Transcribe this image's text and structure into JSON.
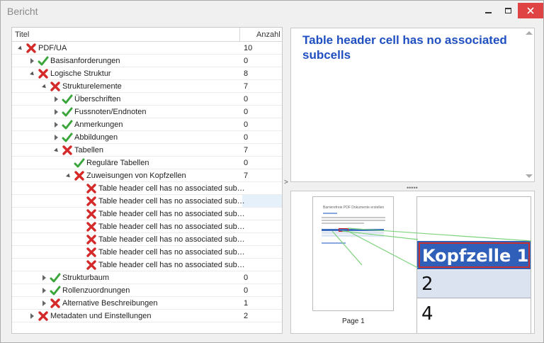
{
  "window": {
    "title": "Bericht"
  },
  "tree": {
    "col_title": "Titel",
    "col_count": "Anzahl",
    "rows": [
      {
        "label": "PDF/UA",
        "count": "10",
        "status": "fail",
        "expander": "open"
      },
      {
        "label": "Basisanforderungen",
        "count": "0",
        "status": "pass",
        "expander": "closed"
      },
      {
        "label": "Logische Struktur",
        "count": "8",
        "status": "fail",
        "expander": "open"
      },
      {
        "label": "Strukturelemente",
        "count": "7",
        "status": "fail",
        "expander": "open"
      },
      {
        "label": "Überschriften",
        "count": "0",
        "status": "pass",
        "expander": "closed"
      },
      {
        "label": "Fussnoten/Endnoten",
        "count": "0",
        "status": "pass",
        "expander": "closed"
      },
      {
        "label": "Anmerkungen",
        "count": "0",
        "status": "pass",
        "expander": "closed"
      },
      {
        "label": "Abbildungen",
        "count": "0",
        "status": "pass",
        "expander": "closed"
      },
      {
        "label": "Tabellen",
        "count": "7",
        "status": "fail",
        "expander": "open"
      },
      {
        "label": "Reguläre Tabellen",
        "count": "0",
        "status": "pass",
        "expander": "none"
      },
      {
        "label": "Zuweisungen von Kopfzellen",
        "count": "7",
        "status": "fail",
        "expander": "open"
      },
      {
        "label": "Table header cell has no associated sub…",
        "count": "",
        "status": "fail",
        "expander": "none"
      },
      {
        "label": "Table header cell has no associated sub…",
        "count": "",
        "status": "fail",
        "expander": "none",
        "selected": true
      },
      {
        "label": "Table header cell has no associated sub…",
        "count": "",
        "status": "fail",
        "expander": "none"
      },
      {
        "label": "Table header cell has no associated sub…",
        "count": "",
        "status": "fail",
        "expander": "none"
      },
      {
        "label": "Table header cell has no associated sub…",
        "count": "",
        "status": "fail",
        "expander": "none"
      },
      {
        "label": "Table header cell has no associated sub…",
        "count": "",
        "status": "fail",
        "expander": "none"
      },
      {
        "label": "Table header cell has no associated sub…",
        "count": "",
        "status": "fail",
        "expander": "none"
      },
      {
        "label": "Strukturbaum",
        "count": "0",
        "status": "pass",
        "expander": "closed"
      },
      {
        "label": "Rollenzuordnungen",
        "count": "0",
        "status": "pass",
        "expander": "closed"
      },
      {
        "label": "Alternative Beschreibungen",
        "count": "1",
        "status": "fail",
        "expander": "closed"
      },
      {
        "label": "Metadaten und Einstellungen",
        "count": "2",
        "status": "fail",
        "expander": "closed"
      }
    ]
  },
  "message": {
    "text": "Table header cell has no associated subcells"
  },
  "preview": {
    "page_label": "Page 1",
    "thumb_title": "Barrierefreie PDF Dokumente erstellen",
    "zoom_header": "Kopfzelle 1",
    "zoom_row2": "2",
    "zoom_row3": "4"
  },
  "colors": {
    "fail": "#d42a2a",
    "pass": "#3aa53a",
    "message": "#1f4fc0",
    "close_button": "#e04343"
  }
}
